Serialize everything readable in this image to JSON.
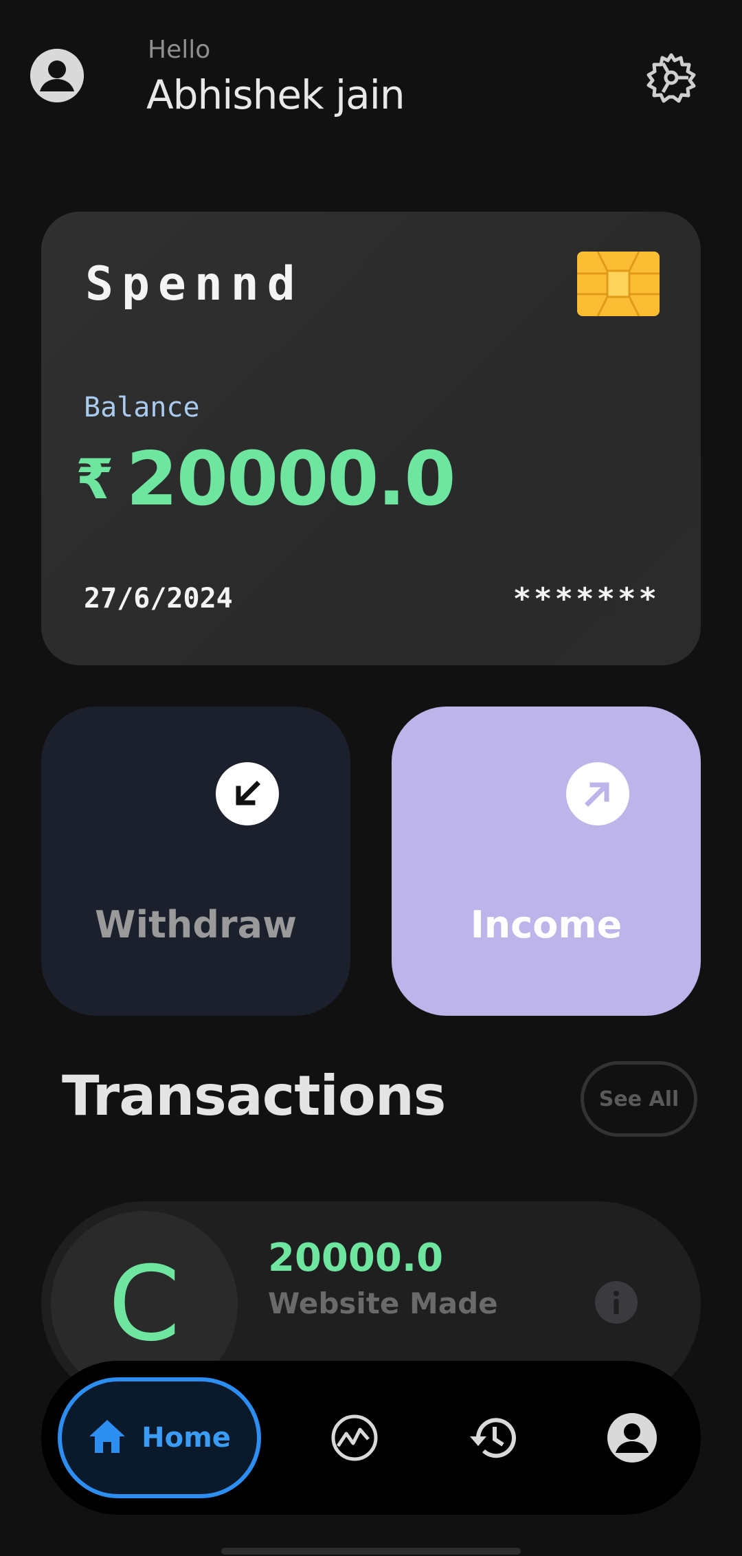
{
  "header": {
    "greeting": "Hello",
    "username": "Abhishek jain",
    "avatar_icon": "account-circle-icon",
    "settings_icon": "gear-icon"
  },
  "card": {
    "brand": "Spennd",
    "chip_icon": "card-chip-icon",
    "balance_label": "Balance",
    "currency_symbol": "₹",
    "balance": "20000.0",
    "date": "27/6/2024",
    "masked_number": "*******"
  },
  "actions": [
    {
      "label": "Withdraw",
      "icon": "arrow-down-left-icon",
      "color": "#1c1f2c"
    },
    {
      "label": "Income",
      "icon": "arrow-up-right-icon",
      "color": "#bdb4ea"
    }
  ],
  "transactions": {
    "title": "Transactions",
    "see_all_label": "See All",
    "items": [
      {
        "initial": "C",
        "amount": "20000.0",
        "description": "Website Made",
        "info_icon": "info-icon"
      }
    ]
  },
  "bottom_nav": {
    "items": [
      {
        "label": "Home",
        "icon": "home-icon",
        "active": true
      },
      {
        "icon": "chart-icon"
      },
      {
        "icon": "history-icon"
      },
      {
        "icon": "profile-icon"
      }
    ]
  },
  "colors": {
    "background": "#111111",
    "accent_green": "#6ee6a0",
    "accent_blue": "#2b8ef0",
    "balance_label": "#a9cbef",
    "income_tile": "#bdb4ea",
    "withdraw_tile": "#1c1f2c"
  }
}
